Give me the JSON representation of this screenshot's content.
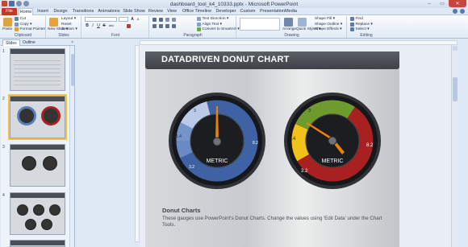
{
  "window": {
    "title": "dashboard_tool_k4_10333.pptx - Microsoft PowerPoint",
    "minimize": "–",
    "maximize": "▭",
    "close": "✕"
  },
  "tabs": {
    "file": "File",
    "items": [
      "Home",
      "Insert",
      "Design",
      "Transitions",
      "Animations",
      "Slide Show",
      "Review",
      "View",
      "Office Timeline",
      "Developer",
      "Custom",
      "PresentationMedia"
    ]
  },
  "ribbon": {
    "clipboard": {
      "label": "Clipboard",
      "paste": "Paste",
      "cut": "Cut",
      "copy": "Copy ▾",
      "format_painter": "Format Painter"
    },
    "slides": {
      "label": "Slides",
      "new_slide": "New Slide ▾",
      "layout": "Layout ▾",
      "reset": "Reset",
      "section": "Section ▾"
    },
    "font": {
      "label": "Font",
      "bold": "B",
      "italic": "I",
      "underline": "U",
      "strike": "S",
      "shadow": "abc",
      "grow": "A",
      "shrink": "A"
    },
    "paragraph": {
      "label": "Paragraph",
      "text_direction": "Text Direction ▾",
      "align_text": "Align Text ▾",
      "convert_smartart": "Convert to SmartArt ▾"
    },
    "drawing": {
      "label": "Drawing",
      "arrange": "Arrange",
      "quick_styles": "Quick Styles ▾",
      "shape_fill": "Shape Fill ▾",
      "shape_outline": "Shape Outline ▾",
      "shape_effects": "Shape Effects ▾"
    },
    "editing": {
      "label": "Editing",
      "find": "Find",
      "replace": "Replace ▾",
      "select": "Select ▾"
    }
  },
  "pane": {
    "tab_slides": "Slides",
    "tab_outline": "Outline",
    "close": "×",
    "thumbnails": [
      {
        "num": "1",
        "title": "DASHBOARD TOOL KIT"
      },
      {
        "num": "2",
        "title": "DATADRIVEN DONUT CHART"
      },
      {
        "num": "3",
        "title": "ADJUSTABLE GAUGES"
      },
      {
        "num": "4",
        "title": "SIMPLE ADJUSTABLE GAUGES"
      }
    ]
  },
  "slide": {
    "title": "DATADRIVEN DONUT CHART",
    "subtitle": "Donut Charts",
    "body": "These gauges use PowerPoint's Donut Charts.  Change the values using 'Edit Data' under the Chart Tools.",
    "gauge1": {
      "center_label": "METRIC",
      "labels": [
        "3",
        "1.4",
        "3.2",
        "8.2"
      ],
      "colors": {
        "light": "#b9cbe8",
        "mid": "#6e8fc6",
        "dark": "#3e62a3",
        "needle": "#e8820e"
      }
    },
    "gauge2": {
      "center_label": "METRIC",
      "labels": [
        "3",
        "1.4",
        "3.2",
        "8.2"
      ],
      "colors": {
        "green": "#6e9b2e",
        "yellow": "#f2c21b",
        "red": "#a8201f",
        "needle": "#e8820e"
      }
    }
  }
}
